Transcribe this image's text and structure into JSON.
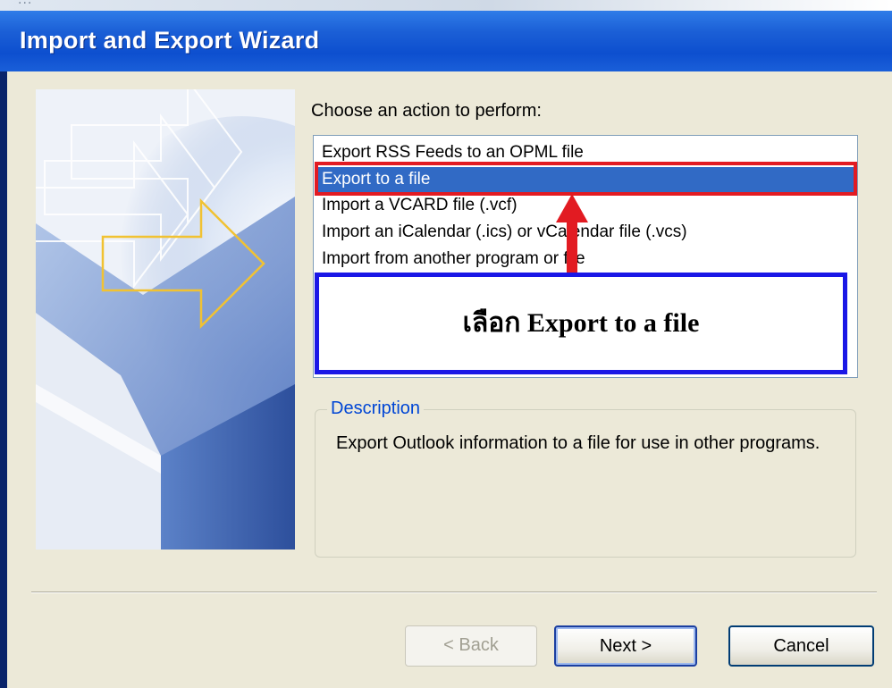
{
  "window": {
    "title": "Import and Export Wizard",
    "top_cropped_text": "..."
  },
  "wizard": {
    "prompt": "Choose an action to perform:",
    "actions": [
      "Export RSS Feeds to an OPML file",
      "Export to a file",
      "Import a VCARD file (.vcf)",
      "Import an iCalendar (.ics) or vCalendar file (.vcs)",
      "Import from another program or file"
    ],
    "selected_action": "Export to a file"
  },
  "annotation": {
    "callout_text": "เลือก Export to a file",
    "red_box_color": "#e21b22",
    "blue_box_color": "#1a17e6",
    "arrow_color": "#e21b22"
  },
  "description": {
    "label": "Description",
    "text": "Export Outlook information to a file for use in other programs."
  },
  "buttons": {
    "back": "< Back",
    "next": "Next >",
    "cancel": "Cancel"
  },
  "colors": {
    "titlebar": "#0d4fcf",
    "selection": "#316ac5",
    "dialog_bg": "#ece9d8",
    "description_label": "#0046d5"
  }
}
